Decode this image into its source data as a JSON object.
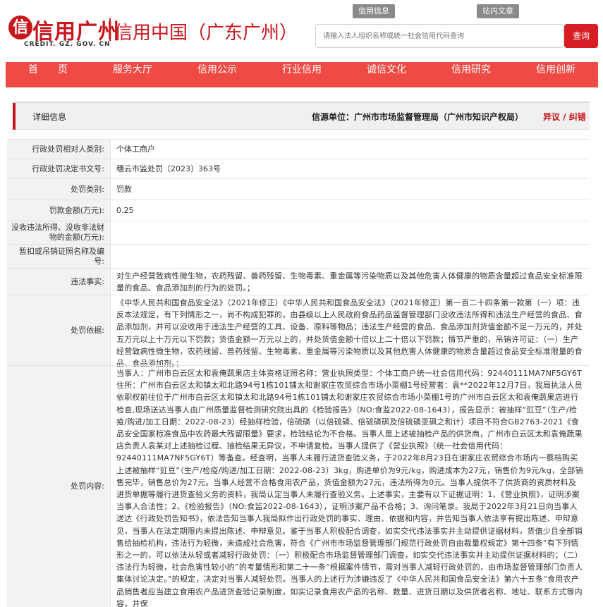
{
  "header": {
    "logo_mark": "信",
    "logo_text": "信用广州",
    "logo_domain": "CREDIT. GZ. GOV. CN",
    "site_title": "信用中国（广东广州）",
    "top_links": [
      "信用信息",
      "站内文章"
    ],
    "search_placeholder": "请输入法人组织名称或统一社会信用代码查询",
    "search_button": "查询"
  },
  "nav": {
    "items": [
      "首　　页",
      "服务大厅",
      "信用公示",
      "行业信用",
      "诚信文化",
      "信用研究",
      "信用创新"
    ]
  },
  "detail": {
    "title": "详细信息",
    "source": "信源单位：广州市市场监督管理局（广州市知识产权局）",
    "error_link": "异议 / 纠错"
  },
  "rows": [
    {
      "label": "行政处罚相对人类别:",
      "value": "个体工商户"
    },
    {
      "label": "行政处罚决定书文号:",
      "value": "穗云市监处罚〔2023〕363号"
    },
    {
      "label": "处罚类别:",
      "value": "罚款"
    },
    {
      "label": "罚款金额(万元):",
      "value": "0.25"
    },
    {
      "label": "没收违法所得、没收非法财物的金额(万元):",
      "value": ""
    },
    {
      "label": "暂扣或吊销证照名称及编号:",
      "value": ""
    },
    {
      "label": "违法事实:",
      "value": "对生产经营致病性微生物，农药残留、兽药残留、生物毒素、重金属等污染物质以及其他危害人体健康的物质含量超过食品安全标准限量的食品、食品添加剂的行为的处罚。；"
    },
    {
      "label": "处罚依据:",
      "value": "《中华人民共和国食品安全法》（2021年修正）《中华人民共和国食品安全法》（2021年修正）第一百二十四条第一款第（一）项：违反本法规定，有下列情形之一，尚不构成犯罪的，由县级以上人民政府食品药品监督管理部门没收违法所得和违法生产经营的食品、食品添加剂，并可以没收用于违法生产经营的工具、设备、原料等物品；违法生产经营的食品、食品添加剂货值金额不足一万元的，并处五万元以上十万元以下罚款；货值金额一万元以上的，并处货值金额十倍以上二十倍以下罚款；情节严重的，吊销许可证：（一）生产经营致病性微生物，农药残留、兽药残留、生物毒素、重金属等污染物质以及其他危害人体健康的物质含量超过食品安全标准限量的食品、食品添加剂。；"
    },
    {
      "label": "处罚内容:",
      "value": "当事人：广州市白云区太和袁俺蔬果店主体资格证照名称：营业执照类型：个体工商户统一社会信用代码：92440111MA7NF5GY6T住所：广州市白云区太和镇太和北路94号1栋101铺太和谢家庄农贸综合市场小菜棚1号经营者：袁**2022年12月7日，我局执法人员依职权前往位于广州市白云区太和镇太和北路94号1栋101铺太和谢家庄农贸综合市场小菜棚1号的广州市白云区太和袁俺蔬果店进行检查,现场送达当事人由广州质量监督检测研究院出具的《检验报告》（NO:食监2022-08-1643），报告显示：被抽样“豇豆”（生产/检疫/购进/加工日期：2022-08-23）经抽样检验，倍硫磷（以倍硫磷、倍硫磷砜及倍硫磷亚砜之和计）项目不符合GB2763-2021《食品安全国家标准食品中农药最大残留限量》要求，检验结论为不合格。当事人是上述被抽检产品的供货商，广州市白云区太和袁俺蔬果店负责人袁某对上述抽检过程、抽检结果无异议，不申请复检。当事人提供了《营业执照》（统一社会信用代码：92440111MA7NF5GY6T）等备查。经查明，当事人未履行进货查验义务，于2022年8月23日在谢家庄农贸综合市场内一蔡档购买上述被抽样“豇豆”（生产/检疫/购进/加工日期：2022-08-23）3kg，购进单价为9元/kg，购进成本为27元，销售价为9元/kg，全部销售完毕，销售总价为27元。当事人经营不合格食用农产品，货值金额为27元，违法所得为0元。当事人提供不了供货商的资质材料及进货单据等履行进货查验义务的资料，我局认定当事人未履行查验义务。上述事实，主要有以下证据证明：1、《营业执照》，证明涉案当事人合法性；2、《检验报告》（NO:食监2022-08-1643），证明涉案产品不合格；3、询问笔录。我局于2022年3月21日向当事人送达《行政处罚告知书》，依法告知当事人我局拟作出行政处罚的事实、理由、依据和内容，并告知当事人依法享有提出陈述、申辩意见，当事人在法定期限内未提出陈述、申辩意见。鉴于当事人积极配合调查，如实交代违法事实并主动提供证据材料，货值少且全部销售给抽检机构，违法行为轻微，未造成社会危害，符合《广州市市场监督管理部门规范行政处罚自由裁量权规定》第十四条“有下列情形之一的，可以依法从轻或者减轻行政处罚：（一）积极配合市场监督管理部门调查，如实交代违法事实并主动提供证据材料的；（二）违法行为轻微，社会危害性较小的”的考量情形和第二十一条“根据案件情节，需对当事人减轻行政处罚的，由市场监督管理部门负责人集体讨论决定。”的规定，决定对当事人减轻处罚。当事人的上述行为涉嫌违反了《中华人民共和国食品安全法》第六十五条“食用农产品销售者应当建立食用农产品进货查验记录制度，如实记录食用农产品的名称、数量、进货日期以及供货者名称、地址、联系方式等内容，并保"
    }
  ]
}
